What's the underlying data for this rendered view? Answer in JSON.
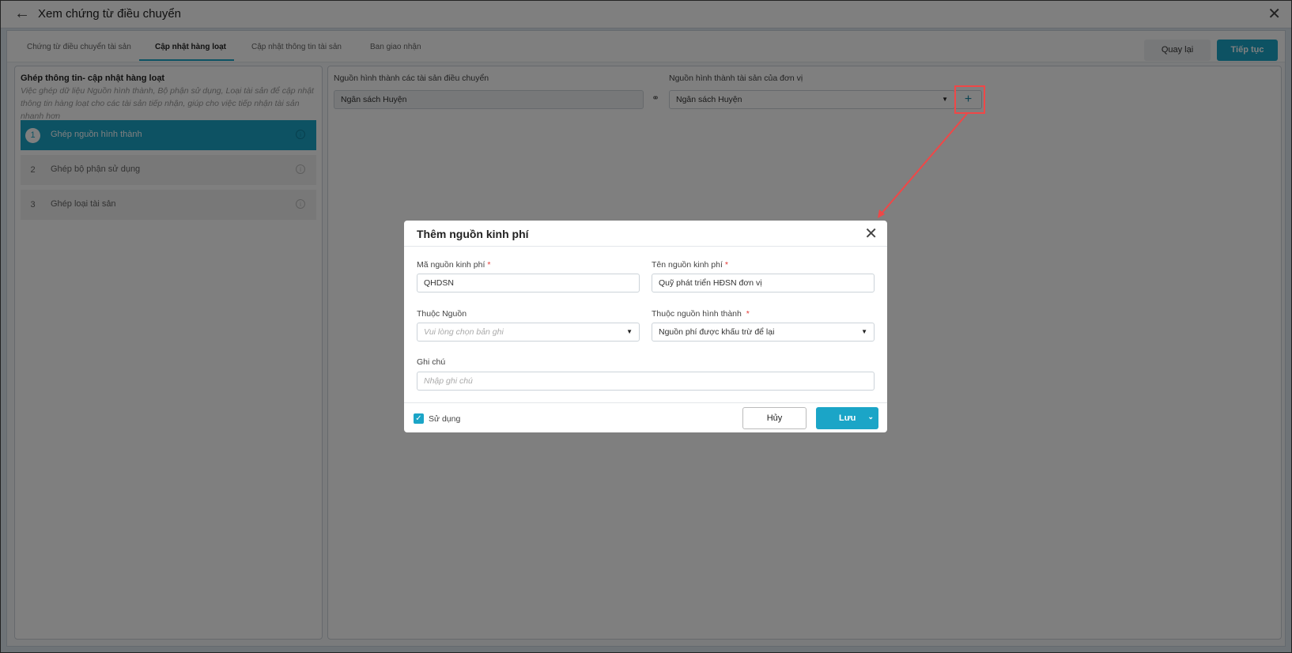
{
  "header": {
    "title": "Xem chứng từ điều chuyển"
  },
  "tabs": [
    "Chứng từ điều chuyển tài sản",
    "Cập nhật hàng loạt",
    "Cập nhật thông tin tài sản",
    "Ban giao nhận"
  ],
  "actions": {
    "back": "Quay lại",
    "next": "Tiếp tục"
  },
  "left": {
    "title": "Ghép thông tin- cập nhật hàng loạt",
    "description": "Việc ghép dữ liệu Nguồn hình thành, Bộ phận sử dụng, Loại tài sản để cập nhật thông tin hàng loạt cho các tài sản tiếp nhận, giúp cho việc tiếp nhận tài sản nhanh hơn",
    "steps": [
      {
        "num": "1",
        "label": "Ghép nguồn hình thành"
      },
      {
        "num": "2",
        "label": "Ghép bộ phận sử dụng"
      },
      {
        "num": "3",
        "label": "Ghép loại tài sản"
      }
    ]
  },
  "mapping": {
    "source_label": "Nguồn hình thành các tài sản điều chuyển",
    "source_value": "Ngân sách Huyện",
    "target_label": "Nguồn hình thành tài sản của đơn vị",
    "target_value": "Ngân sách Huyện",
    "add": "+"
  },
  "dialog": {
    "title": "Thêm nguồn kinh phí",
    "code_label": "Mã nguồn kinh phí",
    "code_value": "QHDSN",
    "name_label": "Tên nguồn kinh phí",
    "name_value": "Quỹ phát triển HĐSN đơn vị",
    "parent_label": "Thuộc Nguồn",
    "parent_placeholder": "Vui lòng chọn bản ghi",
    "formation_label": "Thuộc nguồn hình thành",
    "formation_value": "Nguồn phí được khấu trừ để lại",
    "note_label": "Ghi chú",
    "note_placeholder": "Nhập ghi chú",
    "use_label": "Sử dụng",
    "cancel": "Hủy",
    "save": "Lưu",
    "required": "*"
  }
}
